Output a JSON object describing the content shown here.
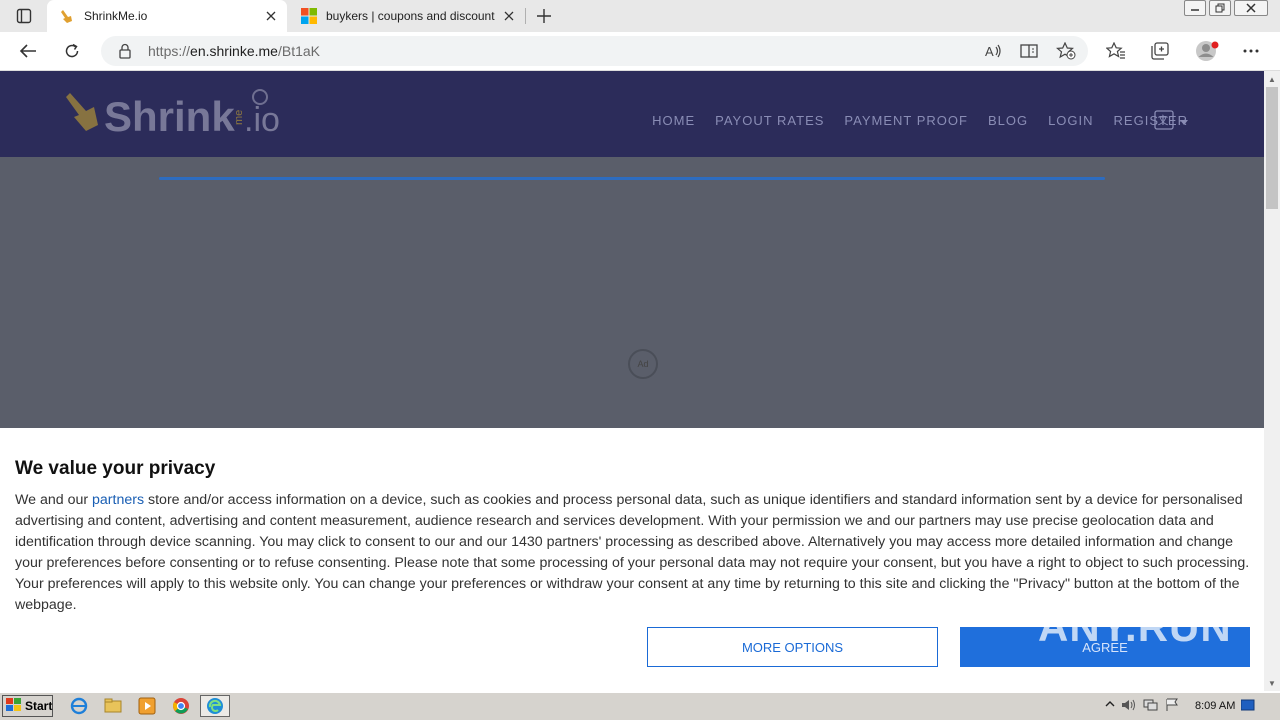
{
  "browser": {
    "tabs": [
      {
        "title": "ShrinkMe.io",
        "active": true
      },
      {
        "title": "buykers | coupons and discount",
        "active": false
      }
    ],
    "url": {
      "scheme": "https://",
      "host": "en.shrinke.me",
      "path": "/Bt1aK"
    }
  },
  "site": {
    "logo_text": "Shrink",
    "logo_me": "me",
    "logo_io": ".io",
    "nav": [
      "HOME",
      "PAYOUT RATES",
      "PAYMENT PROOF",
      "BLOG",
      "LOGIN",
      "REGISTER"
    ],
    "ad_badge": "Ad"
  },
  "consent": {
    "title": "We value your privacy",
    "text_before_link": "We and our ",
    "link": "partners",
    "text_after_link": " store and/or access information on a device, such as cookies and process personal data, such as unique identifiers and standard information sent by a device for personalised advertising and content, advertising and content measurement, audience research and services development. With your permission we and our partners may use precise geolocation data and identification through device scanning. You may click to consent to our and our 1430 partners' processing as described above. Alternatively you may access more detailed information and change your preferences before consenting or to refuse consenting. Please note that some processing of your personal data may not require your consent, but you have a right to object to such processing. Your preferences will apply to this website only. You can change your preferences or withdraw your consent at any time by returning to this site and clicking the \"Privacy\" button at the bottom of the webpage.",
    "more_options": "MORE OPTIONS",
    "agree": "AGREE"
  },
  "watermark": "ANY.RUN",
  "taskbar": {
    "start": "Start",
    "clock": "8:09 AM"
  },
  "colors": {
    "header_bg": "#2c2c5a",
    "page_overlay": "#5a5e6a",
    "accent": "#1f6fdc"
  }
}
